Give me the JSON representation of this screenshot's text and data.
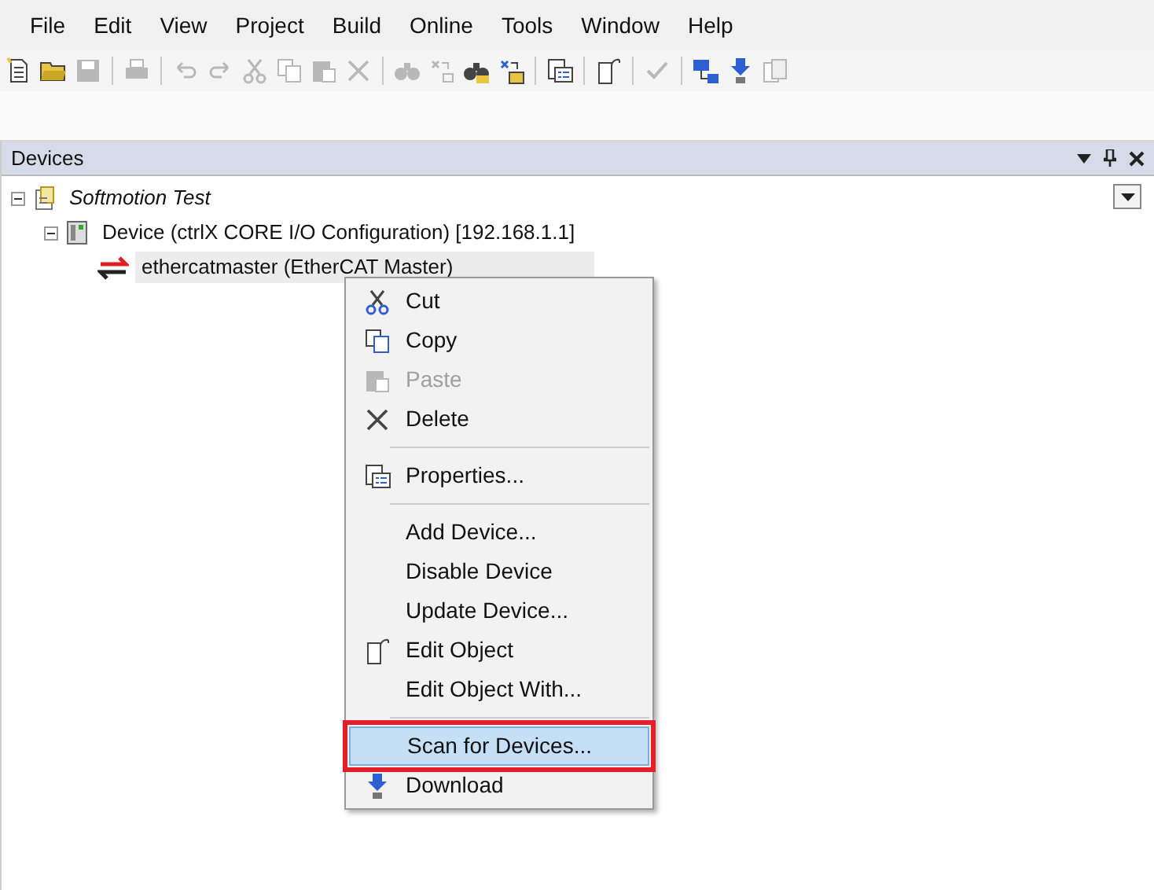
{
  "menu_bar": [
    "File",
    "Edit",
    "View",
    "Project",
    "Build",
    "Online",
    "Tools",
    "Window",
    "Help"
  ],
  "toolbar": [
    {
      "kind": "new",
      "disabled": false
    },
    {
      "kind": "open",
      "disabled": false
    },
    {
      "kind": "save",
      "disabled": true
    },
    {
      "kind": "separator"
    },
    {
      "kind": "print",
      "disabled": true
    },
    {
      "kind": "separator"
    },
    {
      "kind": "undo",
      "disabled": true
    },
    {
      "kind": "redo",
      "disabled": true
    },
    {
      "kind": "cut",
      "disabled": true
    },
    {
      "kind": "copy",
      "disabled": true
    },
    {
      "kind": "paste",
      "disabled": true
    },
    {
      "kind": "delete",
      "disabled": true
    },
    {
      "kind": "separator"
    },
    {
      "kind": "find",
      "disabled": true
    },
    {
      "kind": "replace",
      "disabled": true
    },
    {
      "kind": "find",
      "disabled": false
    },
    {
      "kind": "replace",
      "disabled": false
    },
    {
      "kind": "separator"
    },
    {
      "kind": "properties",
      "disabled": false
    },
    {
      "kind": "separator"
    },
    {
      "kind": "edit",
      "disabled": false
    },
    {
      "kind": "separator"
    },
    {
      "kind": "check",
      "disabled": true
    },
    {
      "kind": "separator"
    },
    {
      "kind": "network",
      "disabled": false
    },
    {
      "kind": "download",
      "disabled": false
    },
    {
      "kind": "pages",
      "disabled": true
    }
  ],
  "panel": {
    "title": "Devices",
    "tree": [
      {
        "label": "Softmotion Test",
        "kind": "project",
        "expanded": true,
        "children": [
          {
            "label": "Device (ctrlX CORE I/O Configuration) [192.168.1.1]",
            "kind": "device",
            "expanded": true,
            "children": [
              {
                "label": "ethercatmaster (EtherCAT Master)",
                "kind": "master",
                "selected": true
              }
            ]
          }
        ]
      }
    ]
  },
  "context_menu": [
    {
      "kind": "cut",
      "label": "Cut",
      "disabled": false,
      "highlighted": false
    },
    {
      "kind": "copy",
      "label": "Copy",
      "disabled": false,
      "highlighted": false
    },
    {
      "kind": "paste",
      "label": "Paste",
      "disabled": true,
      "highlighted": false
    },
    {
      "kind": "delete",
      "label": "Delete",
      "disabled": false,
      "highlighted": false
    },
    {
      "kind": "separator"
    },
    {
      "kind": "properties",
      "label": "Properties...",
      "disabled": false,
      "highlighted": false
    },
    {
      "kind": "separator"
    },
    {
      "kind": "text",
      "label": "Add Device...",
      "disabled": false,
      "highlighted": false
    },
    {
      "kind": "text",
      "label": "Disable Device",
      "disabled": false,
      "highlighted": false
    },
    {
      "kind": "text",
      "label": "Update Device...",
      "disabled": false,
      "highlighted": false
    },
    {
      "kind": "edit",
      "label": "Edit Object",
      "disabled": false,
      "highlighted": false
    },
    {
      "kind": "text",
      "label": "Edit Object With...",
      "disabled": false,
      "highlighted": false
    },
    {
      "kind": "separator"
    },
    {
      "kind": "text",
      "label": "Scan for Devices...",
      "disabled": false,
      "highlighted": true
    },
    {
      "kind": "download",
      "label": "Download",
      "disabled": false,
      "highlighted": false
    }
  ]
}
